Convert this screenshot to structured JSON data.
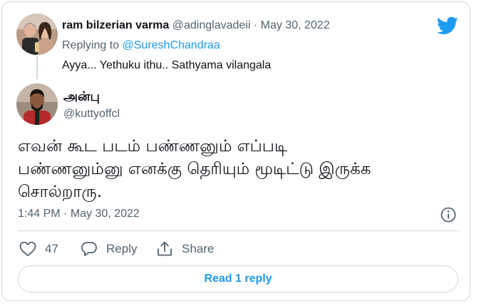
{
  "reply_tweet": {
    "display_name": "ram bilzerian varma",
    "handle": "@adinglavadeii",
    "separator": "·",
    "date": "May 30, 2022",
    "replying_prefix": "Replying to ",
    "replying_to": "@SureshChandraa",
    "text": "Ayya... Yethuku ithu.. Sathyama vilangala",
    "avatar_icon": "avatar-photo-couple"
  },
  "main_tweet": {
    "display_name": "அன்பு",
    "handle": "@kuttyoffcl",
    "avatar_icon": "avatar-photo-man",
    "text_lines": [
      "எவன் கூட படம் பண்ணனும் எப்படி",
      "பண்ணனும்னு எனக்கு தெரியும் மூடிட்டு இருக்க",
      "சொல்றாரு."
    ],
    "time": "1:44 PM",
    "meta_separator": " · ",
    "date": "May 30, 2022"
  },
  "actions": {
    "like_count": "47",
    "reply_label": "Reply",
    "share_label": "Share"
  },
  "read_replies_label": "Read 1 reply",
  "icons": {
    "brand": "twitter-bird-icon",
    "info": "info-icon",
    "like": "heart-icon",
    "reply": "speech-bubble-icon",
    "share": "share-icon"
  },
  "colors": {
    "accent": "#1d9bf0",
    "muted": "#536471",
    "border": "#cfd9de",
    "text": "#0f1419"
  }
}
